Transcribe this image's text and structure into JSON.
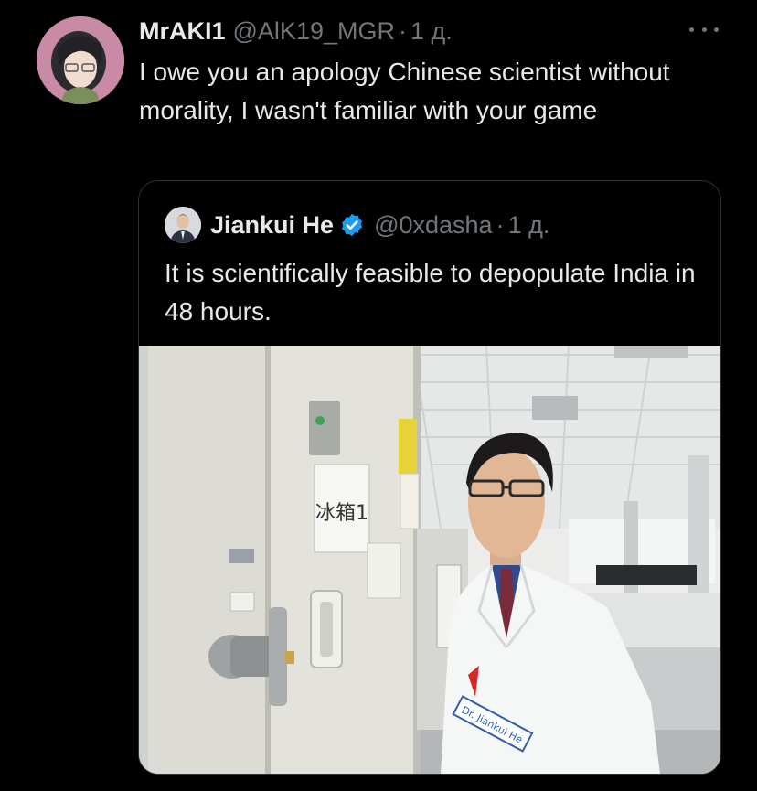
{
  "tweet": {
    "author_name": "MrAKI1",
    "author_handle": "@AlK19_MGR",
    "dot": "·",
    "time": "1 д.",
    "text": "I owe you an apology Chinese scientist without morality, I wasn't familiar with your game",
    "avatar_icon": "anime-character-avatar",
    "more_icon": "more-options-icon"
  },
  "quoted_tweet": {
    "author_name": "Jiankui He",
    "author_handle": "@0xdasha",
    "dot": "·",
    "time": "1 д.",
    "text": "It is scientifically feasible to depopulate India in 48 hours.",
    "verified_color": "#1d9bf0",
    "media": {
      "fridge_label": "冰箱1",
      "coat_badge": "Dr. Jiankui He"
    }
  },
  "colors": {
    "background": "#000000",
    "text_primary": "#e7e9ea",
    "text_secondary": "#71767b",
    "border": "#2f3336",
    "verified": "#1d9bf0"
  }
}
